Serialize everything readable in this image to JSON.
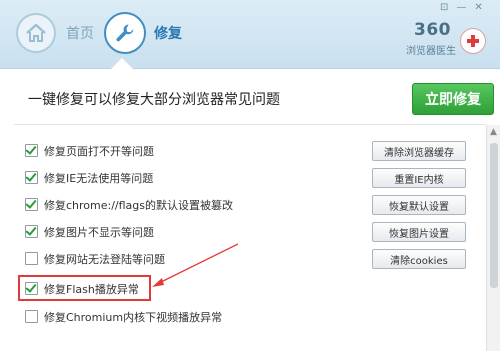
{
  "header": {
    "home_label": "首页",
    "repair_label": "修复",
    "brand_number": "360",
    "brand_name": "浏览器医生",
    "window_controls": [
      "⊡",
      "—",
      "✕"
    ]
  },
  "banner": {
    "title": "一键修复可以修复大部分浏览器常见问题",
    "fix_button": "立即修复"
  },
  "items": [
    {
      "label": "修复页面打不开等问题",
      "checked": true,
      "button": "清除浏览器缓存"
    },
    {
      "label": "修复IE无法使用等问题",
      "checked": true,
      "button": "重置IE内核"
    },
    {
      "label": "修复chrome://flags的默认设置被篡改",
      "checked": true,
      "button": "恢复默认设置"
    },
    {
      "label": "修复图片不显示等问题",
      "checked": true,
      "button": "恢复图片设置"
    },
    {
      "label": "修复网站无法登陆等问题",
      "checked": false,
      "button": "清除cookies"
    },
    {
      "label": "修复Flash播放异常",
      "checked": true,
      "button": ""
    },
    {
      "label": "修复Chromium内核下视频播放异常",
      "checked": false,
      "button": ""
    }
  ],
  "colors": {
    "accent_green": "#2ea036",
    "annotation_red": "#e23a3a",
    "header_blue": "#2b79b3"
  }
}
